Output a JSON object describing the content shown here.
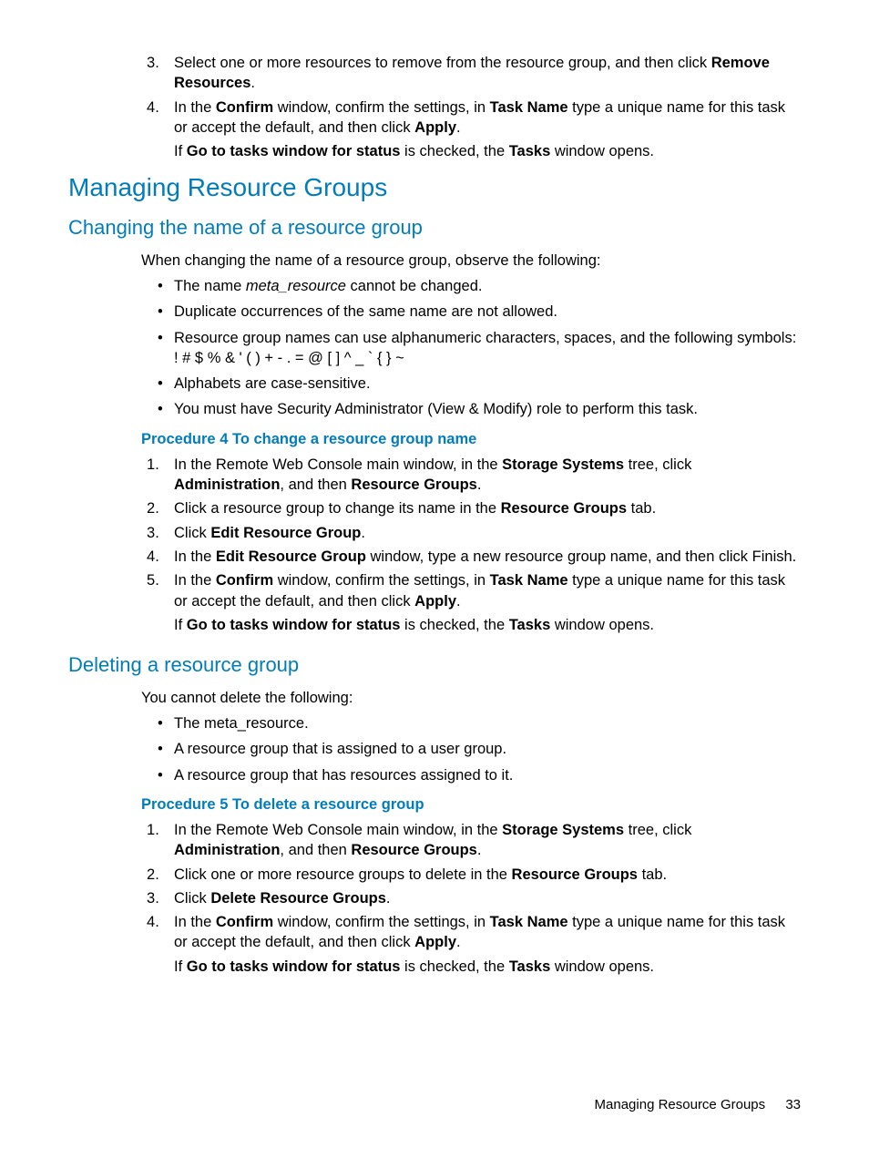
{
  "top_list": {
    "item3": {
      "pre": "Select one or more resources to remove from the resource group, and then click ",
      "b1": "Remove Resources",
      "post": "."
    },
    "item4": {
      "p1a": "In the ",
      "p1b": "Confirm",
      "p1c": " window, confirm the settings, in ",
      "p1d": "Task Name",
      "p1e": " type a unique name for this task or accept the default, and then click ",
      "p1f": "Apply",
      "p1g": ".",
      "p2a": "If ",
      "p2b": "Go to tasks window for status",
      "p2c": " is checked, the ",
      "p2d": "Tasks",
      "p2e": " window opens."
    }
  },
  "h1": "Managing Resource Groups",
  "changing": {
    "title": "Changing the name of a resource group",
    "intro": "When changing the name of a resource group, observe the following:",
    "bul1a": "The name ",
    "bul1b": "meta_resource",
    "bul1c": " cannot be changed.",
    "bul2": "Duplicate occurrences of the same name are not allowed.",
    "bul3a": "Resource group names can use alphanumeric characters, spaces, and the following symbols:",
    "bul3b": "! # $ % & ' ( ) + - . = @ [ ] ^ _ ` { } ~",
    "bul4": "Alphabets are case-sensitive.",
    "bul5": "You must have Security Administrator (View & Modify) role to perform this task.",
    "proc_title": "Procedure 4 To change a resource group name",
    "s1a": "In the Remote Web Console main window, in the ",
    "s1b": "Storage Systems",
    "s1c": " tree, click ",
    "s1d": "Administration",
    "s1e": ", and then ",
    "s1f": "Resource Groups",
    "s1g": ".",
    "s2a": "Click a resource group to change its name in the ",
    "s2b": "Resource Groups",
    "s2c": " tab.",
    "s3a": "Click ",
    "s3b": "Edit Resource Group",
    "s3c": ".",
    "s4a": "In the ",
    "s4b": "Edit Resource Group",
    "s4c": " window, type a new resource group name, and then click Finish.",
    "s5a": "In the ",
    "s5b": "Confirm",
    "s5c": " window, confirm the settings, in ",
    "s5d": "Task Name",
    "s5e": " type a unique name for this task or accept the default, and then click ",
    "s5f": "Apply",
    "s5g": ".",
    "s5p2a": "If ",
    "s5p2b": "Go to tasks window for status",
    "s5p2c": " is checked, the ",
    "s5p2d": "Tasks",
    "s5p2e": " window opens."
  },
  "deleting": {
    "title": "Deleting a resource group",
    "intro": "You cannot delete the following:",
    "bul1": "The meta_resource.",
    "bul2": "A resource group that is assigned to a user group.",
    "bul3": "A resource group that has resources assigned to it.",
    "proc_title": "Procedure 5 To delete a resource group",
    "s1a": "In the Remote Web Console main window, in the ",
    "s1b": "Storage Systems",
    "s1c": " tree, click ",
    "s1d": "Administration",
    "s1e": ", and then ",
    "s1f": "Resource Groups",
    "s1g": ".",
    "s2a": "Click one or more resource groups to delete in the ",
    "s2b": "Resource Groups",
    "s2c": " tab.",
    "s3a": "Click ",
    "s3b": "Delete Resource Groups",
    "s3c": ".",
    "s4a": "In the ",
    "s4b": "Confirm",
    "s4c": " window, confirm the settings, in ",
    "s4d": "Task Name",
    "s4e": " type a unique name for this task or accept the default, and then click ",
    "s4f": "Apply",
    "s4g": ".",
    "s4p2a": "If ",
    "s4p2b": "Go to tasks window for status",
    "s4p2c": " is checked, the ",
    "s4p2d": "Tasks",
    "s4p2e": " window opens."
  },
  "footer": {
    "section": "Managing Resource Groups",
    "page": "33"
  }
}
